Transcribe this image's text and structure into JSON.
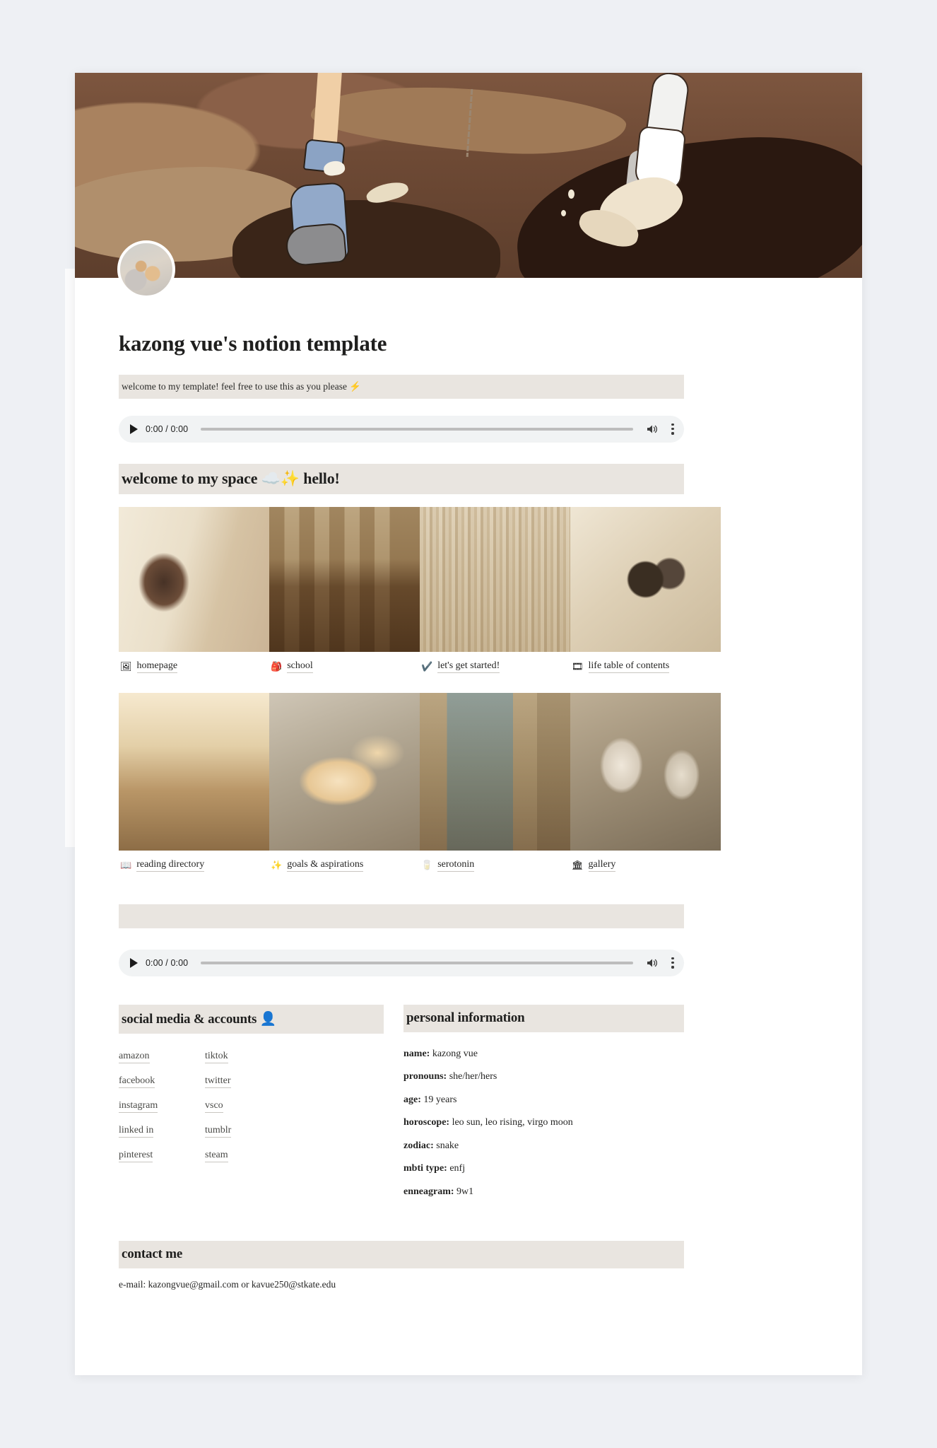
{
  "page": {
    "title": "kazong vue's notion template",
    "welcome_callout": "welcome to my template! feel free to use this as you please ⚡",
    "empty_callout": ""
  },
  "audio_top": {
    "time": "0:00 / 0:00",
    "play_icon": "play-icon",
    "volume_icon": "volume-icon",
    "menu_icon": "kebab-menu-icon"
  },
  "audio_bottom": {
    "time": "0:00 / 0:00",
    "play_icon": "play-icon",
    "volume_icon": "volume-icon",
    "menu_icon": "kebab-menu-icon"
  },
  "welcome_section": {
    "heading": "welcome to my space ☁️✨ hello!",
    "row1": [
      {
        "emoji": "🖼",
        "label": "homepage",
        "art": "t-mirror"
      },
      {
        "emoji": "🎒",
        "label": "school",
        "art": "t-desk"
      },
      {
        "emoji": "✔️",
        "label": "let's get started!",
        "art": "t-books"
      },
      {
        "emoji": "🎞",
        "label": "life table of contents",
        "art": "t-camera"
      }
    ],
    "row2": [
      {
        "emoji": "📖",
        "label": "reading directory",
        "art": "t-piano"
      },
      {
        "emoji": "✨",
        "label": "goals & aspirations",
        "art": "t-clouds"
      },
      {
        "emoji": "🥛",
        "label": "serotonin",
        "art": "t-columns"
      },
      {
        "emoji": "🏛",
        "label": "gallery",
        "art": "t-busts"
      }
    ]
  },
  "social": {
    "heading": "social media & accounts 👤",
    "column_left": [
      "amazon",
      "facebook",
      "instagram",
      "linked in",
      "pinterest"
    ],
    "column_right": [
      "tiktok",
      "twitter",
      "vsco",
      "tumblr",
      "steam"
    ]
  },
  "personal": {
    "heading": "personal information",
    "rows": [
      {
        "label": "name:",
        "value": " kazong vue"
      },
      {
        "label": "pronouns:",
        "value": " she/her/hers"
      },
      {
        "label": "age:",
        "value": " 19 years"
      },
      {
        "label": "horoscope:",
        "value": " leo sun, leo rising, virgo moon"
      },
      {
        "label": "zodiac:",
        "value": " snake"
      },
      {
        "label": "mbti type:",
        "value": " enfj"
      },
      {
        "label": "enneagram:",
        "value": " 9w1"
      }
    ]
  },
  "contact": {
    "heading": "contact me",
    "email_line": "e-mail: kazongvue@gmail.com or kavue250@stkate.edu"
  },
  "colors": {
    "callout_bg": "#e9e5e0",
    "page_bg": "#ffffff",
    "canvas_bg": "#eef0f4",
    "cover_brown": "#6d4a36",
    "text": "#1f1f1e"
  }
}
